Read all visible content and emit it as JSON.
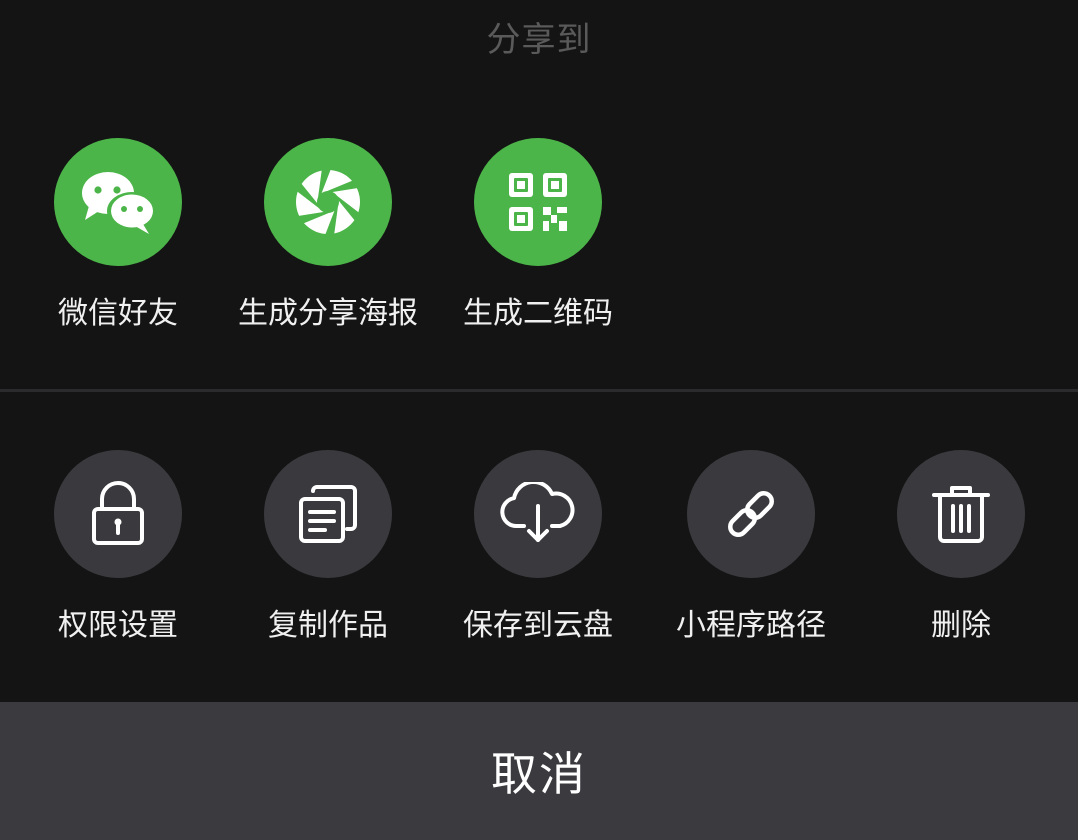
{
  "sheet": {
    "title": "分享到"
  },
  "share_options": [
    {
      "label": "微信好友",
      "icon": "wechat-icon"
    },
    {
      "label": "生成分享海报",
      "icon": "camera-aperture-icon"
    },
    {
      "label": "生成二维码",
      "icon": "qr-code-icon"
    }
  ],
  "action_options": [
    {
      "label": "权限设置",
      "icon": "lock-icon"
    },
    {
      "label": "复制作品",
      "icon": "copy-documents-icon"
    },
    {
      "label": "保存到云盘",
      "icon": "cloud-download-icon"
    },
    {
      "label": "小程序路径",
      "icon": "link-icon"
    },
    {
      "label": "删除",
      "icon": "trash-icon"
    }
  ],
  "cancel": {
    "label": "取消"
  },
  "colors": {
    "background": "#141414",
    "share_circle": "#4cb549",
    "action_circle": "#3a393e",
    "cancel_bar": "#3b3a3f",
    "title_text": "#5a5a5a",
    "label_text": "#f0f0f0"
  }
}
